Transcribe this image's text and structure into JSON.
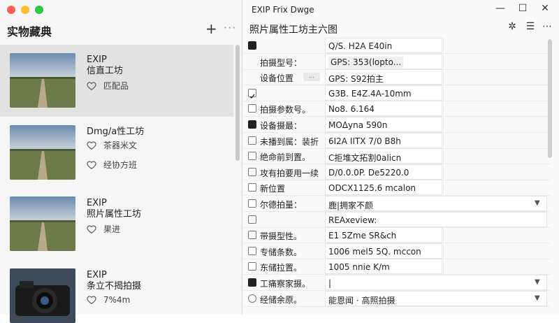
{
  "left": {
    "title": "实物藏典",
    "add_icon": "+",
    "more_icon": "···",
    "items": [
      {
        "title": "EXIP\n信直工坊",
        "meta": [
          "匹配品"
        ],
        "selected": true
      },
      {
        "title": "Dmg/a性工坊",
        "meta": [
          "茶器米文",
          "经协方班"
        ],
        "selected": false
      },
      {
        "title": "EXIP\n照片属性工坊",
        "meta": [
          "果进"
        ],
        "selected": false
      },
      {
        "title": "EXIP\n条立不揭拍摄",
        "meta": [
          "7%4m"
        ],
        "selected": false
      }
    ]
  },
  "right": {
    "window_title": "EXIP Frix Dwge",
    "detail_title": "照片属性工坊主六图",
    "rows": [
      {
        "label": "",
        "value": "Q/S. H2A E40in",
        "box": "filled",
        "wide": false
      },
      {
        "label": "拍摄型号：",
        "value": "GPS: 353(lopto...",
        "box": "none",
        "wide": false,
        "chip": true
      },
      {
        "label": "设备位置",
        "value": "GPS: S92拍主",
        "box": "none",
        "wide": false,
        "btn": true
      },
      {
        "label": "",
        "value": "G3B. E4Z.4A-10mm",
        "box": "check",
        "wide": false
      },
      {
        "label": "拍摄参数号。",
        "value": "No8. 6.164",
        "box": "empty",
        "wide": false
      },
      {
        "label": "设备摄最：",
        "value": "MOΔyna 590n",
        "box": "filled",
        "wide": false
      },
      {
        "label": "未播到属：装折",
        "value": "6I2A IITX 7/0 B8h",
        "box": "empty",
        "wide": false
      },
      {
        "label": "绝命前到置。",
        "value": "C拒堆文拓割0alicn",
        "box": "empty",
        "wide": false
      },
      {
        "label": "攻有拍要用一续",
        "value": "D/0.0.0P. De5220.0",
        "box": "empty",
        "wide": false
      },
      {
        "label": "新位置",
        "value": "ODCX1125.6 mcalon",
        "box": "empty",
        "wide": false
      },
      {
        "label": "尔德拍量：",
        "value": "鹿|拥家不颜",
        "box": "empty",
        "wide": true,
        "arrow": true
      },
      {
        "label": "",
        "value": "REAxeview:",
        "box": "empty",
        "wide": true
      },
      {
        "label": "带摄型性。",
        "value": "E1 5Zme SR&ch",
        "box": "empty",
        "wide": false
      },
      {
        "label": "专储条数。",
        "value": "1006 mel5 5Q. mccon",
        "box": "empty",
        "wide": false
      },
      {
        "label": "东储拉置。",
        "value": "1005 nnie K/m",
        "box": "empty",
        "wide": false
      },
      {
        "label": "工痛察家摄。",
        "value": "|",
        "box": "filled",
        "wide": true,
        "arrow": true
      },
      {
        "label": "经储余原。",
        "value": "能恩闻 · 高照拍摄",
        "box": "circle",
        "wide": true,
        "arrow": true
      }
    ]
  },
  "icons": {
    "heart": "heart-icon",
    "gear": "gear-icon",
    "list": "list-icon",
    "more": "more-icon"
  }
}
